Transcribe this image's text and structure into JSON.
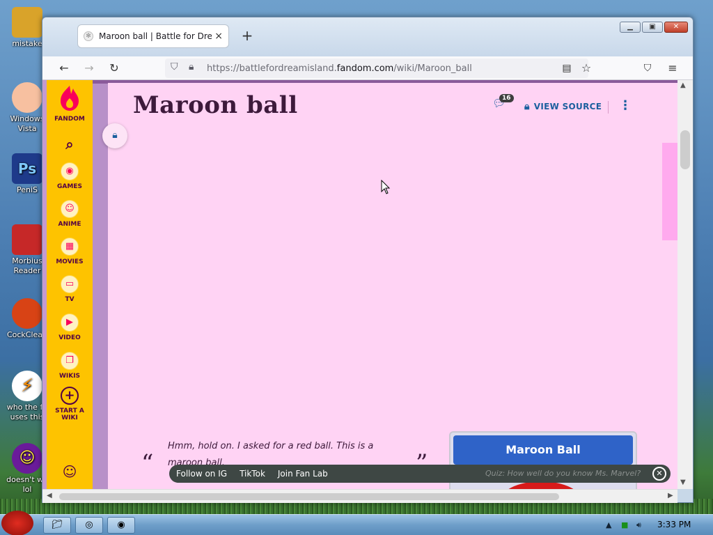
{
  "desktop": {
    "icons": [
      {
        "label": "mistake",
        "color": "#d9a32a"
      },
      {
        "label": "Windows Vista",
        "color": "#f7c0a0"
      },
      {
        "label": "PeniS",
        "color": "#1e3a8a"
      },
      {
        "label": "Morbius Reader",
        "color": "#c62828"
      },
      {
        "label": "CockClean",
        "color": "#d84315"
      },
      {
        "label": "who the fu uses this",
        "color": "#ff8f00"
      },
      {
        "label": "doesn't wo lol",
        "color": "#6a1b9a"
      }
    ]
  },
  "browser": {
    "tab_title": "Maroon ball | Battle for Dream I",
    "tab_close": "×",
    "new_tab": "+",
    "url_prefix": "https://battlefordreamisland.",
    "url_host": "fandom.com",
    "url_path": "/wiki/Maroon_ball"
  },
  "fandom_rail": {
    "logo_label": "FANDOM",
    "items": [
      {
        "label": "GAMES",
        "icon": "gamepad-icon"
      },
      {
        "label": "ANIME",
        "icon": "anime-face-icon"
      },
      {
        "label": "MOVIES",
        "icon": "clapperboard-icon"
      },
      {
        "label": "TV",
        "icon": "tv-icon"
      },
      {
        "label": "VIDEO",
        "icon": "play-icon"
      },
      {
        "label": "WIKIS",
        "icon": "book-icon"
      },
      {
        "label": "START A WIKI",
        "icon": "plus-circle-icon"
      }
    ]
  },
  "page": {
    "title": "Maroon ball",
    "comment_count": "16",
    "view_source": "VIEW SOURCE",
    "quote": "Hmm, hold on. I asked for a red ball. This is a maroon ball.",
    "quote_open": "“",
    "quote_close": "”",
    "infobox_title": "Maroon Ball",
    "infobox_color": "#2f63c8"
  },
  "social_bar": {
    "links": [
      "Follow on IG",
      "TikTok",
      "Join Fan Lab"
    ],
    "quiz": "Quiz: How well do you know Ms. Marvel?"
  },
  "taskbar": {
    "clock": "3:33 PM"
  }
}
